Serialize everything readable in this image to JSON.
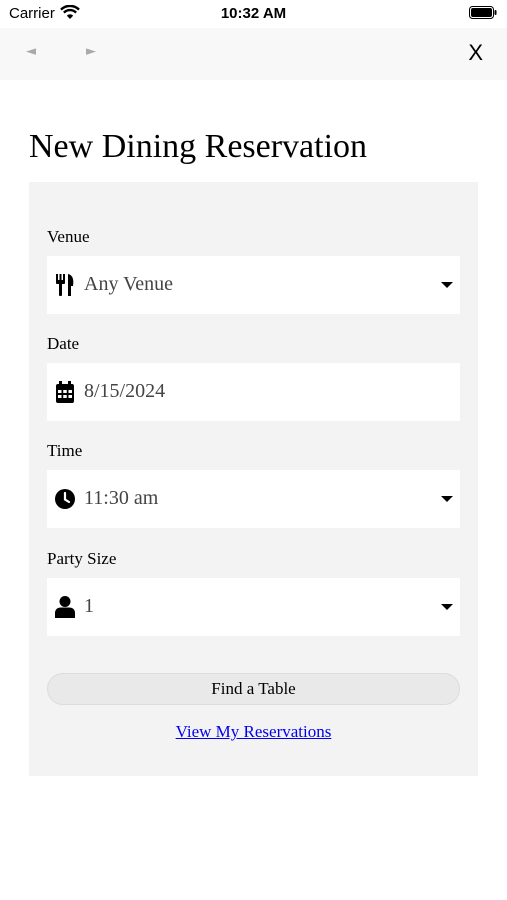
{
  "status_bar": {
    "carrier": "Carrier",
    "time": "10:32 AM"
  },
  "nav": {
    "back_label": "◄",
    "forward_label": "►",
    "close_label": "X"
  },
  "page": {
    "title": "New Dining Reservation"
  },
  "form": {
    "venue": {
      "label": "Venue",
      "value": "Any Venue",
      "icon": "fork-knife-icon"
    },
    "date": {
      "label": "Date",
      "value": "8/15/2024",
      "icon": "calendar-icon"
    },
    "time": {
      "label": "Time",
      "value": "11:30 am",
      "icon": "clock-icon"
    },
    "party_size": {
      "label": "Party Size",
      "value": "1",
      "icon": "person-icon"
    },
    "find_button": "Find a Table",
    "view_link": "View My Reservations"
  },
  "colors": {
    "panel_bg": "#f3f3f3",
    "link": "#0000ee",
    "nav_bg": "#f8f8f8"
  }
}
